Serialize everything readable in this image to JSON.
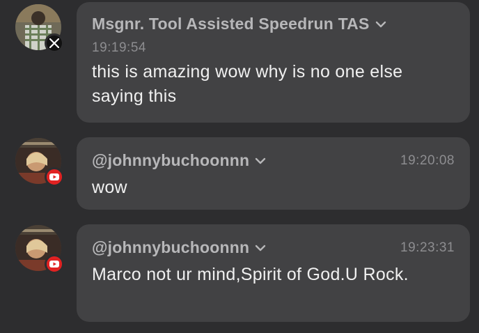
{
  "messages": [
    {
      "platform": "x",
      "platform_icon": "x-logo-icon",
      "author": "Msgnr. Tool Assisted Speedrun TAS",
      "time": "19:19:54",
      "text": "this is amazing wow why is no one else saying this"
    },
    {
      "platform": "youtube",
      "platform_icon": "youtube-logo-icon",
      "author": "@johnnybuchoonnn",
      "time": "19:20:08",
      "text": "wow"
    },
    {
      "platform": "youtube",
      "platform_icon": "youtube-logo-icon",
      "author": "@johnnybuchoonnn",
      "time": "19:23:31",
      "text": "Marco not ur mind,Spirit of God.U Rock."
    }
  ],
  "colors": {
    "background": "#2d2d2f",
    "bubble": "#424244",
    "author": "#b7b7b9",
    "timestamp": "#8d8d90",
    "text": "#f0f0f0",
    "youtube": "#e12222",
    "x": "#111111"
  }
}
